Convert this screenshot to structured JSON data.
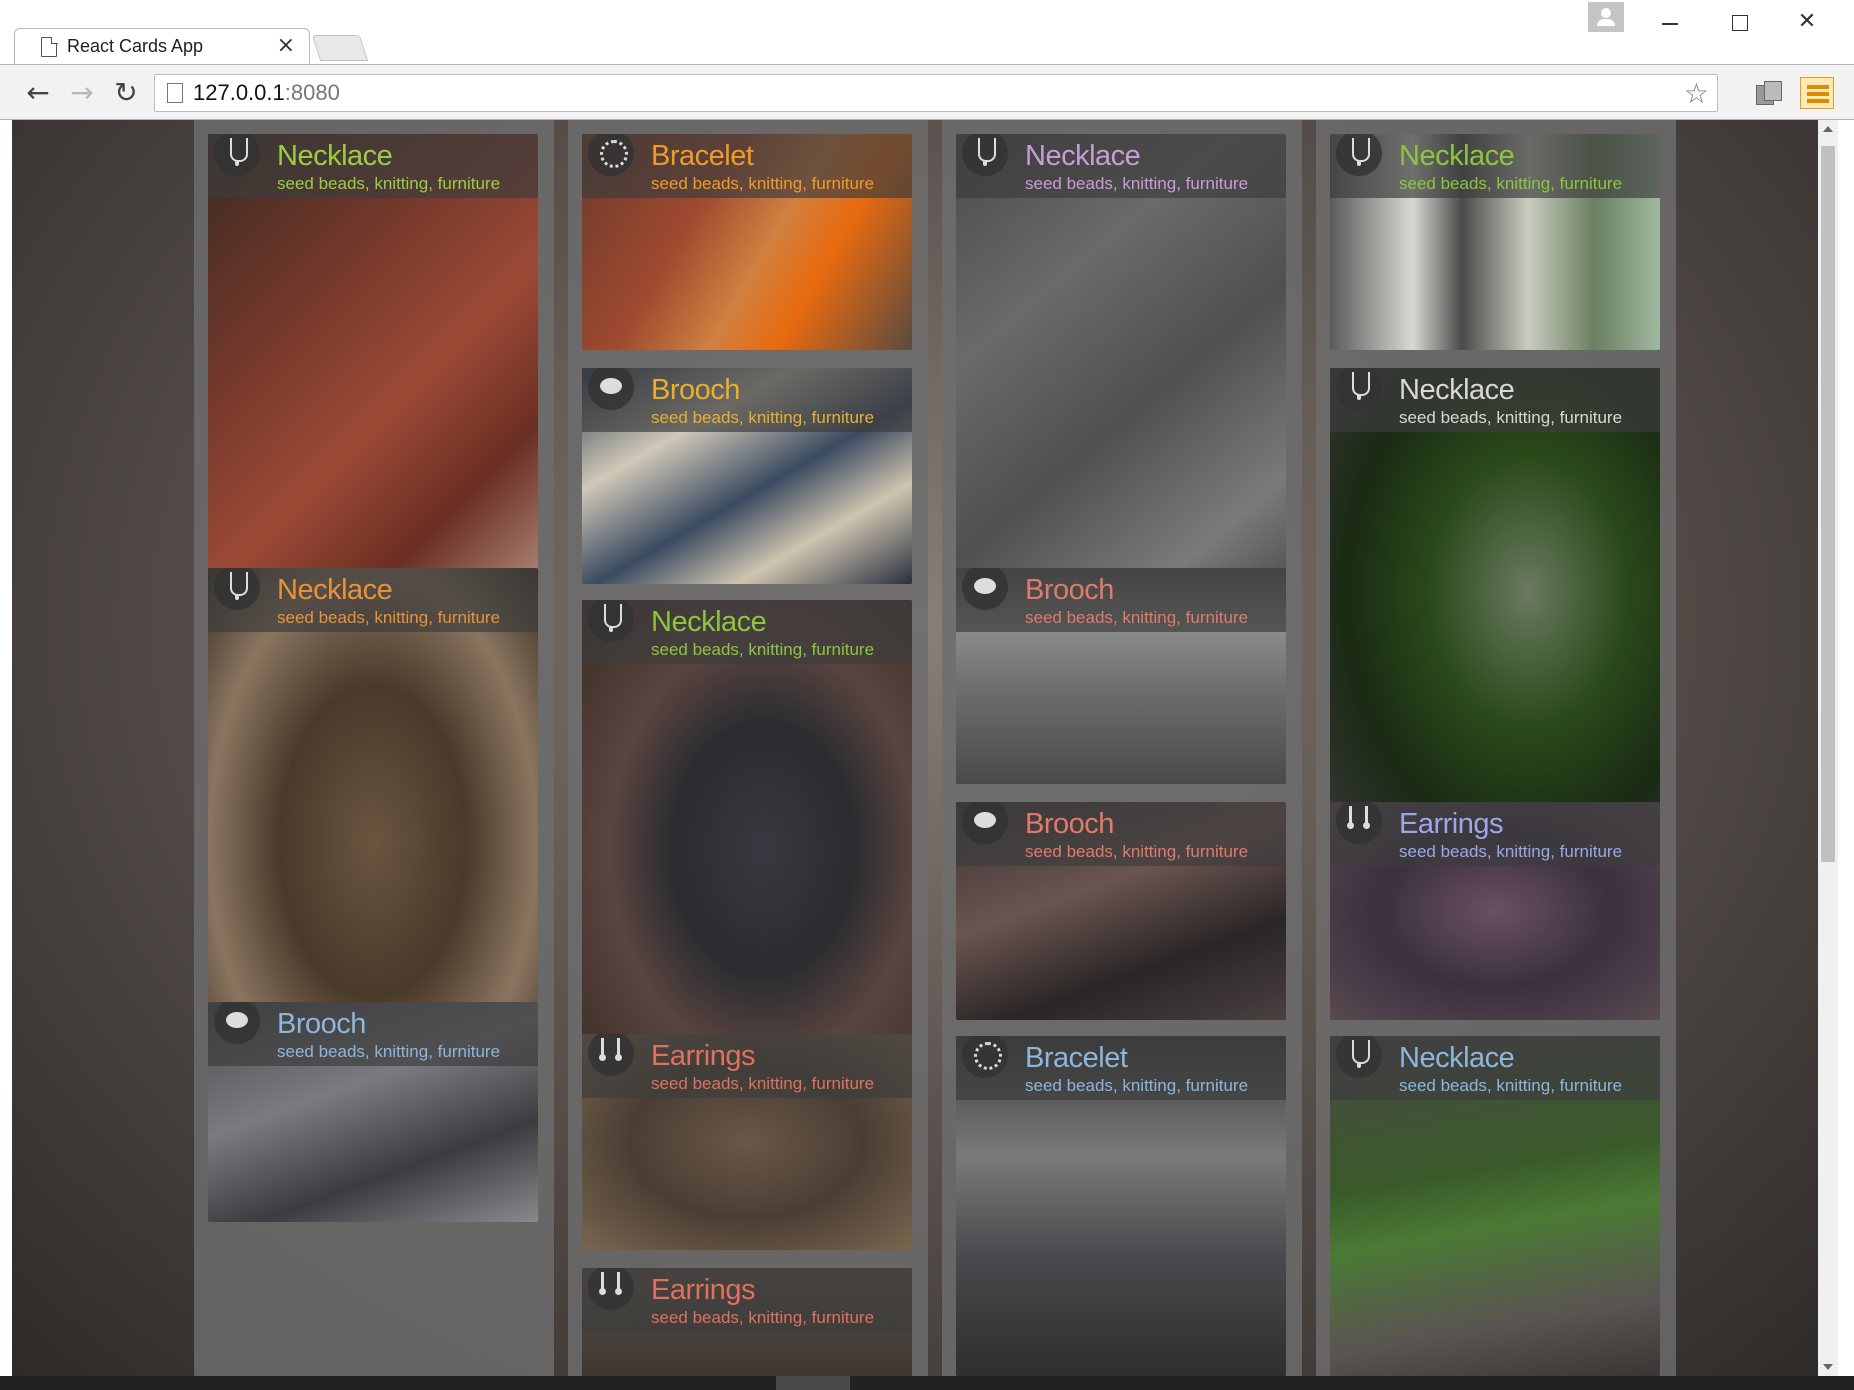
{
  "browser": {
    "tab_title": "React Cards App",
    "tab_close": "×",
    "url_host": "127.0.0.1",
    "url_port": ":8080",
    "back_glyph": "←",
    "forward_glyph": "→",
    "reload_glyph": "↻",
    "star_glyph": "☆",
    "close_glyph": "✕"
  },
  "colors": {
    "green": "#8cc63f",
    "orange": "#e8923a",
    "amber": "#e8b030",
    "lavender": "#c89cd8",
    "salmon": "#e07a6a",
    "periwinkle": "#9aa8e8",
    "steelblue": "#8db6dc",
    "light": "#d8d8d8"
  },
  "columns": [
    {
      "cards": [
        {
          "title": "Necklace",
          "tags": "seed beads, knitting, furniture",
          "icon": "necklace-icon",
          "color": "#9ccc44",
          "photo": "linear-gradient(135deg,#3a2a22 0%,#7a3a2c 35%,#9c4a36 55%,#6a2e22 75%,#c0a090 100%)"
        },
        {
          "title": "Necklace",
          "tags": "seed beads, knitting, furniture",
          "icon": "necklace-icon",
          "color": "#e8923a",
          "photo": "radial-gradient(ellipse at 50% 55%,#6a5540 0%,#4a3a2a 40%,#8a7560 70%,#3a2e24 100%)"
        },
        {
          "title": "Brooch",
          "tags": "seed beads, knitting, furniture",
          "icon": "brooch-icon",
          "color": "#8db6dc",
          "photo": "linear-gradient(160deg,#4a4a4e 0%,#7a7a80 40%,#3c3c40 70%,#8a8a8e 100%)"
        }
      ]
    },
    {
      "cards": [
        {
          "title": "Bracelet",
          "tags": "seed beads, knitting, furniture",
          "icon": "bracelet-icon",
          "color": "#f09a2a",
          "photo": "linear-gradient(120deg,#6a3a2a 0%,#a04a30 35%,#d08040 55%,#e86a10 70%,#5a4a40 100%)"
        },
        {
          "title": "Brooch",
          "tags": "seed beads, knitting, furniture",
          "icon": "brooch-icon",
          "color": "#e8b030",
          "photo": "linear-gradient(150deg,#2a3a50 0%,#d0c8b8 30%,#3a4a60 55%,#cfc4b0 75%,#2a3040 100%)"
        },
        {
          "title": "Necklace",
          "tags": "seed beads, knitting, furniture",
          "icon": "necklace-icon",
          "color": "#8cc63f",
          "photo": "radial-gradient(ellipse at 55% 50%,#3a3840 0%,#2a2c30 35%,#5a4440 60%,#3a2a24 100%)"
        },
        {
          "title": "Earrings",
          "tags": "seed beads, knitting, furniture",
          "icon": "earrings-icon",
          "color": "#e07060",
          "photo": "radial-gradient(ellipse at 50% 50%,#6a5848 0%,#4a3e34 50%,#7a6650 100%)"
        },
        {
          "title": "Earrings",
          "tags": "seed beads, knitting, furniture",
          "icon": "earrings-icon",
          "color": "#e07060",
          "photo": "linear-gradient(180deg,#5a5048 0%,#3a3430 100%)"
        }
      ]
    },
    {
      "cards": [
        {
          "title": "Necklace",
          "tags": "seed beads, knitting, furniture",
          "icon": "necklace-icon",
          "color": "#c89cd8",
          "photo": "linear-gradient(140deg,#4a4a4a 0%,#6a6a68 30%,#505050 55%,#7a7a78 80%,#404040 100%)"
        },
        {
          "title": "Brooch",
          "tags": "seed beads, knitting, furniture",
          "icon": "brooch-icon",
          "color": "#e07a6a",
          "photo": "linear-gradient(180deg,#555 0%,#8a8a88 30%,#6a6a68 60%,#4a4a48 100%)"
        },
        {
          "title": "Brooch",
          "tags": "seed beads, knitting, furniture",
          "icon": "brooch-icon",
          "color": "#e07a6a",
          "photo": "linear-gradient(160deg,#3a3434 0%,#6a5450 40%,#2a2626 70%,#4a4040 100%)"
        },
        {
          "title": "Bracelet",
          "tags": "seed beads, knitting, furniture",
          "icon": "bracelet-icon",
          "color": "#8db6dc",
          "photo": "linear-gradient(180deg,#3a3a3c 0%,#7a7a7c 35%,#4a4a4e 65%,#2e2e30 100%)"
        }
      ]
    },
    {
      "cards": [
        {
          "title": "Necklace",
          "tags": "seed beads, knitting, furniture",
          "icon": "necklace-icon",
          "color": "#8cc63f",
          "photo": "linear-gradient(90deg,#5a5a58 0%,#d8d8d4 25%,#4a4a48 40%,#c8ccc0 60%,#6a8060 80%,#a0b8a0 100%)"
        },
        {
          "title": "Necklace",
          "tags": "seed beads, knitting, furniture",
          "icon": "necklace-icon",
          "color": "#d8d8d8",
          "photo": "radial-gradient(ellipse at 60% 45%,#6a7a60 0%,#2a4a1a 35%,#1a2a14 65%,#3a3a3a 100%)"
        },
        {
          "title": "Earrings",
          "tags": "seed beads, knitting, furniture",
          "icon": "earrings-icon",
          "color": "#9aa8e8",
          "photo": "radial-gradient(ellipse at 50% 50%,#6a5060 0%,#3a3040 50%,#5a4a50 100%)"
        },
        {
          "title": "Necklace",
          "tags": "seed beads, knitting, furniture",
          "icon": "necklace-icon",
          "color": "#8db6dc",
          "photo": "linear-gradient(170deg,#4a4a48 0%,#3a5a2a 40%,#4a7a34 55%,#5a5452 80%,#3a3634 100%)"
        }
      ]
    }
  ]
}
